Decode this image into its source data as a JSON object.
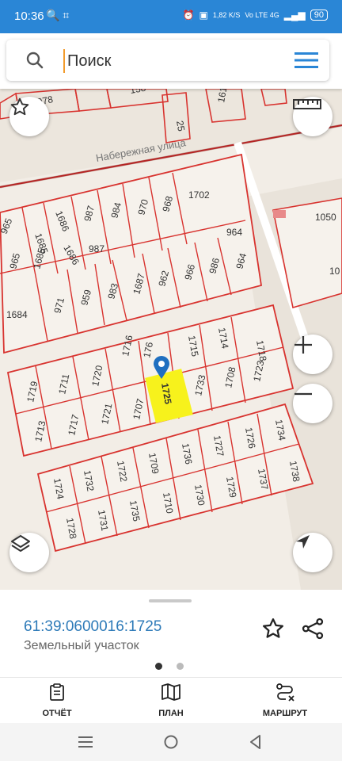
{
  "status_bar": {
    "time": "10:36",
    "left_icons": "🔍 ⌗",
    "speed": "1,82 K/S",
    "network": "Vo LTE 4G",
    "battery": "90"
  },
  "search": {
    "placeholder": "Поиск"
  },
  "map": {
    "street_label": "Набережная улица",
    "selected_parcel": "1725",
    "parcels": [
      "978",
      "158",
      "161",
      "25",
      "1702",
      "1050",
      "965",
      "1685",
      "1686",
      "987",
      "984",
      "970",
      "968",
      "964",
      "10",
      "965",
      "1685",
      "1686",
      "987",
      "959",
      "983",
      "1687",
      "962",
      "966",
      "986",
      "964",
      "1684",
      "971",
      "1718",
      "1715",
      "1714",
      "1716",
      "1720",
      "1711",
      "1719",
      "1723",
      "1708",
      "1733",
      "1707",
      "1721",
      "1717",
      "1713",
      "1726",
      "1734",
      "1727",
      "1736",
      "1709",
      "1722",
      "1732",
      "1724",
      "1738",
      "1737",
      "1729",
      "1730",
      "1710",
      "1735",
      "1731",
      "1728",
      "176"
    ]
  },
  "info_sheet": {
    "cadastral_number": "61:39:0600016:1725",
    "property_type": "Земельный участок"
  },
  "toolbar": {
    "report_label": "ОТЧЁТ",
    "plan_label": "ПЛАН",
    "route_label": "МАРШРУТ"
  },
  "colors": {
    "accent": "#2a86d6",
    "parcel_border": "#d8332f",
    "highlight": "#f7f21c",
    "link": "#2d7ab8"
  }
}
